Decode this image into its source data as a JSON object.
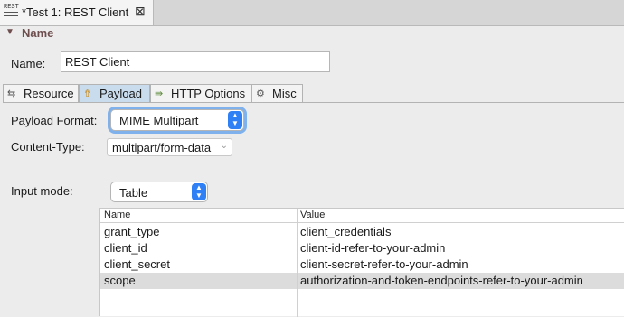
{
  "editor": {
    "tab_title": "*Test 1: REST Client",
    "icon_text": "REST"
  },
  "name_section": {
    "title": "Name",
    "label": "Name:",
    "value": "REST Client"
  },
  "tabs": [
    {
      "label": "Resource",
      "icon": "resource-icon"
    },
    {
      "label": "Payload",
      "icon": "payload-icon",
      "active": true
    },
    {
      "label": "HTTP Options",
      "icon": "http-options-icon"
    },
    {
      "label": "Misc",
      "icon": "misc-icon"
    }
  ],
  "payload": {
    "format_label": "Payload Format:",
    "format_value": "MIME Multipart",
    "content_type_label": "Content-Type:",
    "content_type_value": "multipart/form-data",
    "input_mode_label": "Input mode:",
    "input_mode_value": "Table"
  },
  "table": {
    "columns": [
      "Name",
      "Value"
    ],
    "rows": [
      {
        "name": "grant_type",
        "value": "client_credentials"
      },
      {
        "name": "client_id",
        "value": "client-id-refer-to-your-admin"
      },
      {
        "name": "client_secret",
        "value": "client-secret-refer-to-your-admin"
      },
      {
        "name": "scope",
        "value": "authorization-and-token-endpoints-refer-to-your-admin",
        "selected": true
      }
    ]
  },
  "colors": {
    "accent": "#2f7ff5",
    "focus": "#7fb1ec",
    "section_title": "#6e4e4e",
    "active_tab": "#c9dcee",
    "selected_row": "#dcdcdc"
  }
}
